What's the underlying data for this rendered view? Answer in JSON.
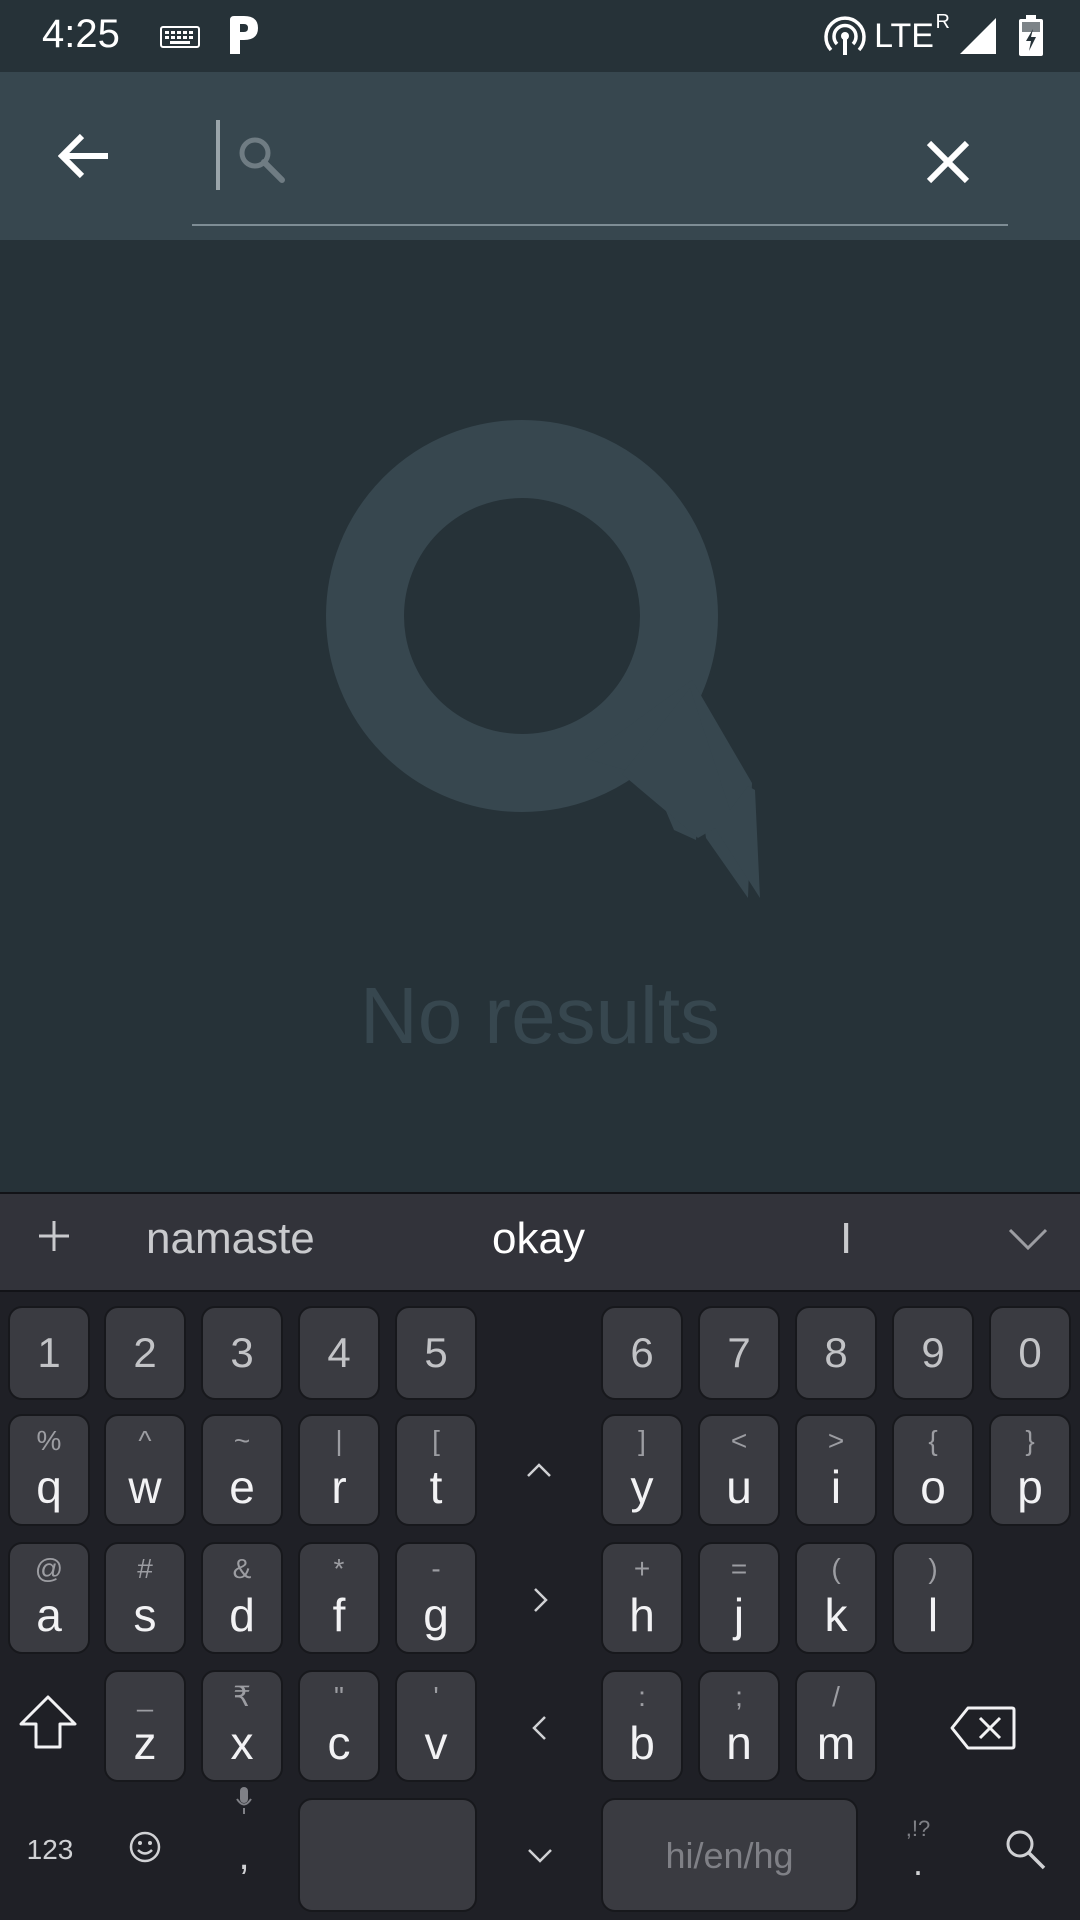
{
  "status_bar": {
    "time": "4:25",
    "network": "LTE",
    "roaming": "R",
    "icons": [
      "keyboard-icon",
      "p-app-icon",
      "hotspot-icon",
      "signal-icon",
      "battery-charging-icon"
    ]
  },
  "toolbar": {
    "back_icon": "arrow-left-icon",
    "search_placeholder": "",
    "search_value": "",
    "clear_icon": "close-icon"
  },
  "empty_state": {
    "message": "No results",
    "illustration": "search-speech-bubble-icon"
  },
  "keyboard": {
    "suggestions": [
      "namaste",
      "okay",
      "I"
    ],
    "plus_icon": "plus-icon",
    "collapse_icon": "chevron-down-icon",
    "number_row": [
      "1",
      "2",
      "3",
      "4",
      "5",
      "6",
      "7",
      "8",
      "9",
      "0"
    ],
    "row1": [
      {
        "hint": "%",
        "key": "q"
      },
      {
        "hint": "^",
        "key": "w"
      },
      {
        "hint": "~",
        "key": "e"
      },
      {
        "hint": "|",
        "key": "r"
      },
      {
        "hint": "[",
        "key": "t"
      },
      {
        "hint": "]",
        "key": "y"
      },
      {
        "hint": "<",
        "key": "u"
      },
      {
        "hint": ">",
        "key": "i"
      },
      {
        "hint": "{",
        "key": "o"
      },
      {
        "hint": "}",
        "key": "p"
      }
    ],
    "row2": [
      {
        "hint": "@",
        "key": "a"
      },
      {
        "hint": "#",
        "key": "s"
      },
      {
        "hint": "&",
        "key": "d"
      },
      {
        "hint": "*",
        "key": "f"
      },
      {
        "hint": "-",
        "key": "g"
      },
      {
        "hint": "+",
        "key": "h"
      },
      {
        "hint": "=",
        "key": "j"
      },
      {
        "hint": "(",
        "key": "k"
      },
      {
        "hint": ")",
        "key": "l"
      }
    ],
    "row3": [
      {
        "hint": "_",
        "key": "z"
      },
      {
        "hint": "₹",
        "key": "x"
      },
      {
        "hint": "\"",
        "key": "c"
      },
      {
        "hint": "'",
        "key": "v"
      },
      {
        "hint": ":",
        "key": "b"
      },
      {
        "hint": ";",
        "key": "n"
      },
      {
        "hint": "/",
        "key": "m"
      }
    ],
    "bottom": {
      "numbers_label": "123",
      "comma": ",",
      "language": "hi/en/hg",
      "punct_hint": ",!?",
      "period": "."
    }
  }
}
